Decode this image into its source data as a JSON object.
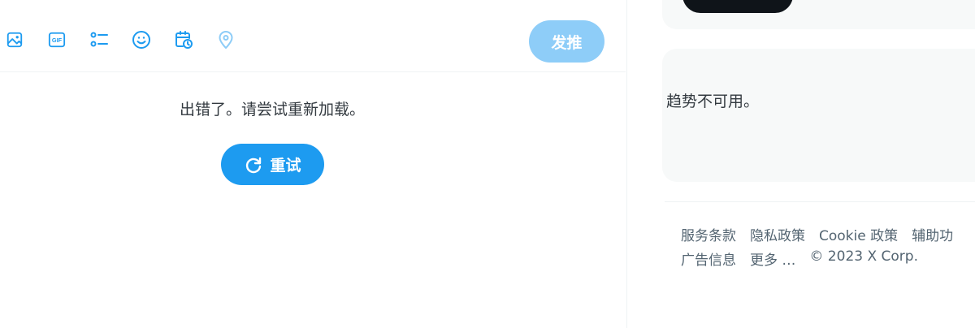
{
  "composer": {
    "toolbar_icons": [
      "image-icon",
      "gif-icon",
      "poll-icon",
      "emoji-icon",
      "schedule-icon",
      "location-icon"
    ],
    "gif_text": "GIF",
    "post_label": "发推",
    "accent_color": "#1d9bf0",
    "post_disabled_color": "#8ecdf8"
  },
  "timeline": {
    "error_message": "出错了。请尝试重新加载。",
    "retry_label": "重试"
  },
  "sidebar": {
    "trends_message": "趋势不可用。",
    "footer_links_row1": [
      "服务条款",
      "隐私政策",
      "Cookie 政策",
      "辅助功"
    ],
    "footer_links_row2": [
      "广告信息",
      "更多 …"
    ],
    "copyright": "© 2023 X Corp."
  }
}
